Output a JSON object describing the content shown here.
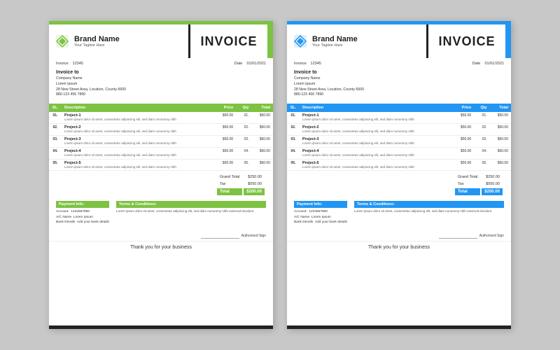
{
  "invoices": [
    {
      "variant": "green",
      "brand": {
        "name": "Brand Name",
        "tagline": "Your Tagline Hare"
      },
      "header_title": "INVOICE",
      "meta": {
        "invoice_label": "Invoice:",
        "invoice_number": "12345",
        "date_label": "Date",
        "date_value": "01/01/2021"
      },
      "invoice_to": {
        "title": "Invoice to",
        "company": "Company Name",
        "ac_name": "Lorem Ipsum",
        "address": "28 New Street Area, Location, County-5600",
        "phone": "880-123 456 7890"
      },
      "table": {
        "headers": [
          "SL.",
          "Description",
          "Price",
          "Qty",
          "Total"
        ],
        "rows": [
          {
            "sl": "01.",
            "name": "Project-1",
            "desc": "Lorem ipsum dolor sit amet, consectetur adipiscing elit, sed diam nonummy nibh",
            "price": "$50.00",
            "qty": "01.",
            "total": "$50.00"
          },
          {
            "sl": "02.",
            "name": "Project-2",
            "desc": "Lorem ipsum dolor sit amet, consectetur adipiscing elit, sed diam nonummy nibh",
            "price": "$50.00",
            "qty": "02.",
            "total": "$50.00"
          },
          {
            "sl": "03.",
            "name": "Project-3",
            "desc": "Lorem ipsum dolor sit amet, consectetur adipiscing elit, sed diam nonummy nibh",
            "price": "$50.00",
            "qty": "03.",
            "total": "$50.00"
          },
          {
            "sl": "04.",
            "name": "Project-4",
            "desc": "Lorem ipsum dolor sit amet, consectetur adipiscing elit, sed diam nonummy nibh",
            "price": "$50.00",
            "qty": "04.",
            "total": "$50.00"
          },
          {
            "sl": "05.",
            "name": "Project-5",
            "desc": "Lorem ipsum dolor sit amet, consectetur adipiscing elit, sed diam nonummy nibh",
            "price": "$50.00",
            "qty": "05.",
            "total": "$50.00"
          }
        ],
        "grand_total_label": "Grand Total",
        "grand_total_value": "$250.00",
        "tax_label": "Tax",
        "tax_value": "$050.00",
        "total_label": "Total",
        "total_value": "$200.00"
      },
      "payment": {
        "title": "Payment Info:",
        "account_label": "Account:",
        "account_value": "1234567890",
        "ac_name_label": "A/C Name",
        "ac_name_value": "Lorem Ipsum",
        "bank_label": "Bank Derails",
        "bank_value": "Add your bank details"
      },
      "terms": {
        "title": "Terms & Conditions:",
        "text": "Lorem ipsum dolor sit amet, consectetur adipiscing elit, sed diam nonummy nibh euismod tincidunt"
      },
      "auth_sign": "Authorised Sign",
      "footer": "Thank you for your business"
    },
    {
      "variant": "blue",
      "brand": {
        "name": "Brand Name",
        "tagline": "Your Tagline Hare"
      },
      "header_title": "INVOICE",
      "meta": {
        "invoice_label": "Invoice:",
        "invoice_number": "12345",
        "date_label": "Date",
        "date_value": "01/01/2021"
      },
      "invoice_to": {
        "title": "Invoice to",
        "company": "Company Name",
        "ac_name": "Lorem Ipsum",
        "address": "28 New Street Area, Location, County-5600",
        "phone": "880-123 456 7890"
      },
      "table": {
        "headers": [
          "SL.",
          "Description",
          "Price",
          "Qty",
          "Total"
        ],
        "rows": [
          {
            "sl": "01.",
            "name": "Project-1",
            "desc": "Lorem ipsum dolor sit amet, consectetur adipiscing elit, sed diam nonummy nibh",
            "price": "$50.00",
            "qty": "01.",
            "total": "$50.00"
          },
          {
            "sl": "02.",
            "name": "Project-2",
            "desc": "Lorem ipsum dolor sit amet, consectetur adipiscing elit, sed diam nonummy nibh",
            "price": "$50.00",
            "qty": "02.",
            "total": "$50.00"
          },
          {
            "sl": "03.",
            "name": "Project-3",
            "desc": "Lorem ipsum dolor sit amet, consectetur adipiscing elit, sed diam nonummy nibh",
            "price": "$50.00",
            "qty": "03.",
            "total": "$50.00"
          },
          {
            "sl": "04.",
            "name": "Project-4",
            "desc": "Lorem ipsum dolor sit amet, consectetur adipiscing elit, sed diam nonummy nibh",
            "price": "$50.00",
            "qty": "04.",
            "total": "$50.00"
          },
          {
            "sl": "05.",
            "name": "Project-5",
            "desc": "Lorem ipsum dolor sit amet, consectetur adipiscing elit, sed diam nonummy nibh",
            "price": "$50.00",
            "qty": "05.",
            "total": "$50.00"
          }
        ],
        "grand_total_label": "Grand Total",
        "grand_total_value": "$250.00",
        "tax_label": "Tax",
        "tax_value": "$050.00",
        "total_label": "Total",
        "total_value": "$200.00"
      },
      "payment": {
        "title": "Payment Info:",
        "account_label": "Account:",
        "account_value": "1234567890",
        "ac_name_label": "A/C Name",
        "ac_name_value": "Lorem Ipsum",
        "bank_label": "Bank Derails",
        "bank_value": "Add your bank details"
      },
      "terms": {
        "title": "Terms & Conditions:",
        "text": "Lorem ipsum dolor sit amet, consectetur adipiscing elit, sed diam nonummy nibh euismod tincidunt"
      },
      "auth_sign": "Authorised Sign",
      "footer": "Thank you for your business"
    }
  ]
}
